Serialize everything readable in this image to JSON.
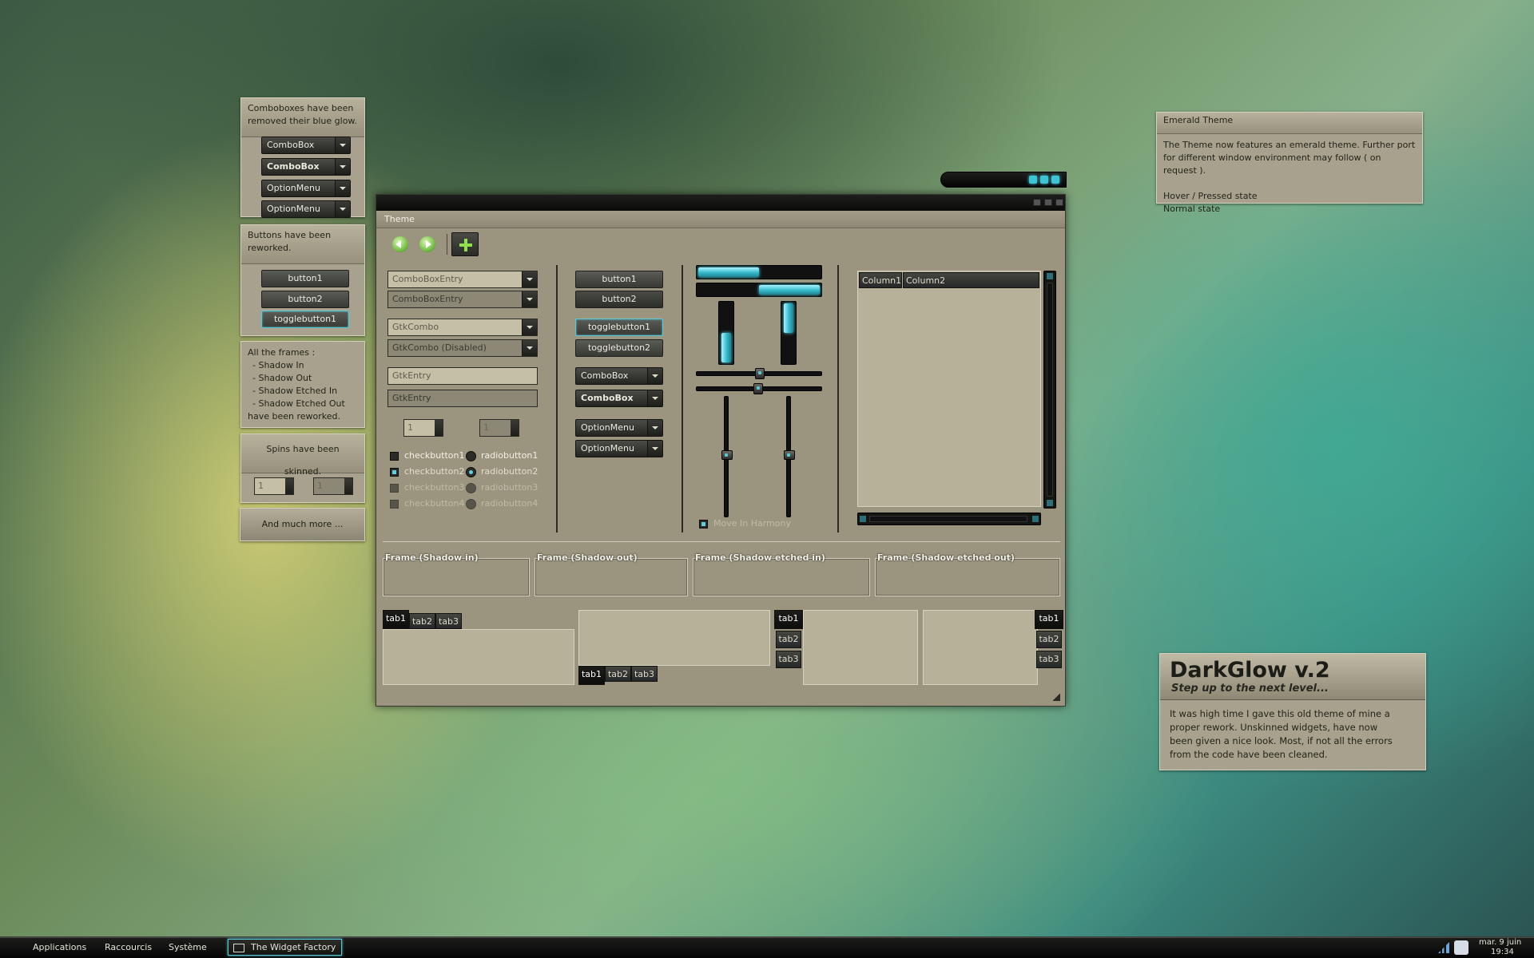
{
  "sidebar_panels": {
    "combo_note": "Comboboxes have been removed their blue glow.",
    "combos": [
      "ComboBox",
      "ComboBox",
      "OptionMenu",
      "OptionMenu"
    ],
    "buttons_note": "Buttons have been reworked.",
    "buttons": [
      "button1",
      "button2",
      "togglebutton1"
    ],
    "frames_note": [
      "All the frames :",
      "- Shadow In",
      "- Shadow Out",
      "- Shadow Etched In",
      "- Shadow Etched Out",
      "have been reworked."
    ],
    "spins_note": "Spins have been skinned.",
    "spin_values": [
      "1",
      "1"
    ],
    "more_note": "And much more ..."
  },
  "emerald_panel": {
    "title": "Emerald Theme",
    "lines": [
      "The Theme now features an emerald theme. Further port",
      "for different window environment may follow ( on request )."
    ],
    "hover_state": "Hover / Pressed state",
    "normal_state": "Normal state"
  },
  "darkglow_panel": {
    "title": "DarkGlow v.2",
    "subtitle": "Step up to the next level...",
    "body": [
      "It was high time I gave this old theme of mine a",
      "proper rework. Unskinned widgets, have now",
      "been given a nice look. Most, if not all the errors",
      "from the code have been cleaned."
    ]
  },
  "window": {
    "title": "Theme",
    "col1": {
      "entries": [
        "ComboBoxEntry",
        "ComboBoxEntry",
        "GtkCombo",
        "GtkCombo (Disabled)",
        "GtkEntry",
        "GtkEntry"
      ],
      "spins": [
        "1",
        "1"
      ],
      "checks": [
        "checkbutton1",
        "checkbutton2",
        "checkbutton3",
        "checkbutton4"
      ],
      "radios": [
        "radiobutton1",
        "radiobutton2",
        "radiobutton3",
        "radiobutton4"
      ]
    },
    "col2": {
      "buttons": [
        "button1",
        "button2",
        "togglebutton1",
        "togglebutton2"
      ],
      "combos": [
        "ComboBox",
        "ComboBox"
      ],
      "options": [
        "OptionMenu",
        "OptionMenu"
      ]
    },
    "col3": {
      "progress": [
        0.5,
        0.5
      ],
      "vprogress": [
        0.5,
        0.5
      ],
      "harmony": "Move In Harmony"
    },
    "tree": {
      "columns": [
        "Column1",
        "Column2"
      ]
    },
    "frames": [
      "Frame (Shadow in)",
      "Frame (Shadow out)",
      "Frame (Shadow etched in)",
      "Frame (Shadow etched out)"
    ],
    "tabs": [
      "tab1",
      "tab2",
      "tab3"
    ]
  },
  "taskbar": {
    "menus": [
      "Applications",
      "Raccourcis",
      "Système"
    ],
    "window_button": "The Widget Factory",
    "date": "mar.  9 juin",
    "time": "19:34"
  }
}
